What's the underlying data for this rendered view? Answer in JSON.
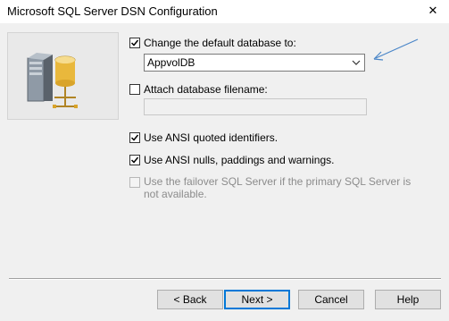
{
  "window": {
    "title": "Microsoft SQL Server DSN Configuration",
    "close_glyph": "✕",
    "icon": "database-server-icon"
  },
  "options": {
    "change_default_db": {
      "label": "Change the default database to:",
      "checked": true
    },
    "database_select": {
      "value": "AppvolDB",
      "icon": "chevron-down-icon"
    },
    "attach_db_filename": {
      "label": "Attach database filename:",
      "checked": false
    },
    "filename_value": "",
    "ansi_quoted": {
      "label": "Use ANSI quoted identifiers.",
      "checked": true
    },
    "ansi_nulls": {
      "label": "Use ANSI nulls, paddings and warnings.",
      "checked": true
    },
    "failover": {
      "label": "Use the failover SQL Server if the primary SQL Server is not available.",
      "checked": false,
      "enabled": false
    }
  },
  "annotation": {
    "icon": "arrow-pointer-icon",
    "color": "#4a86c8"
  },
  "buttons": {
    "back": "< Back",
    "next": "Next >",
    "cancel": "Cancel",
    "help": "Help"
  },
  "colors": {
    "accent": "#0078d7",
    "background": "#f0f0f0"
  }
}
